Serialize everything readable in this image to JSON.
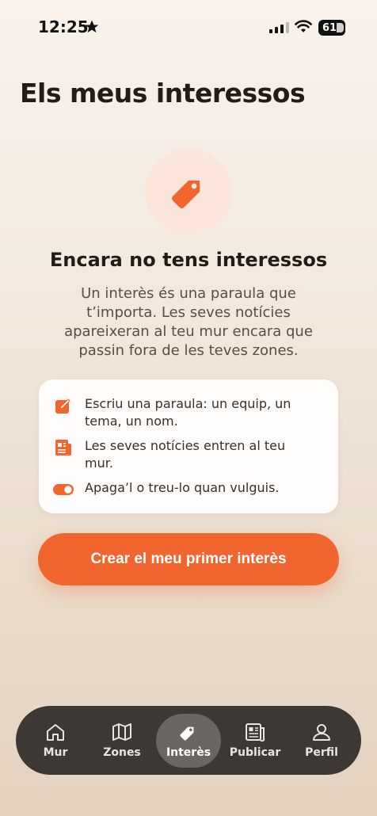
{
  "status": {
    "time": "12:25",
    "battery": "61"
  },
  "page": {
    "title": "Els meus interessos"
  },
  "empty_state": {
    "icon": "tag-icon",
    "title": "Encara no tens interessos",
    "description": "Un interès és una paraula que t’importa. Les seves notícies apareixeran al teu mur encara que passin fora de les teves zones."
  },
  "info_card": {
    "items": [
      {
        "icon": "edit-icon",
        "text": "Escriu una paraula: un equip, un tema, un nom."
      },
      {
        "icon": "newspaper-icon",
        "text": "Les seves notícies entren al teu mur."
      },
      {
        "icon": "toggle-icon",
        "text": "Apaga’l o treu-lo quan vulguis."
      }
    ]
  },
  "cta": {
    "label": "Crear el meu primer interès"
  },
  "tabbar": {
    "tabs": [
      {
        "label": "Mur",
        "icon": "home-icon"
      },
      {
        "label": "Zones",
        "icon": "map-icon"
      },
      {
        "label": "Interès",
        "icon": "tag-icon",
        "active": true
      },
      {
        "label": "Publicar",
        "icon": "newspaper-icon"
      },
      {
        "label": "Perfil",
        "icon": "user-icon"
      }
    ]
  },
  "colors": {
    "accent": "#f0662e",
    "hero_bg": "#fbe5da",
    "tabbar_bg": "#3d3834"
  }
}
